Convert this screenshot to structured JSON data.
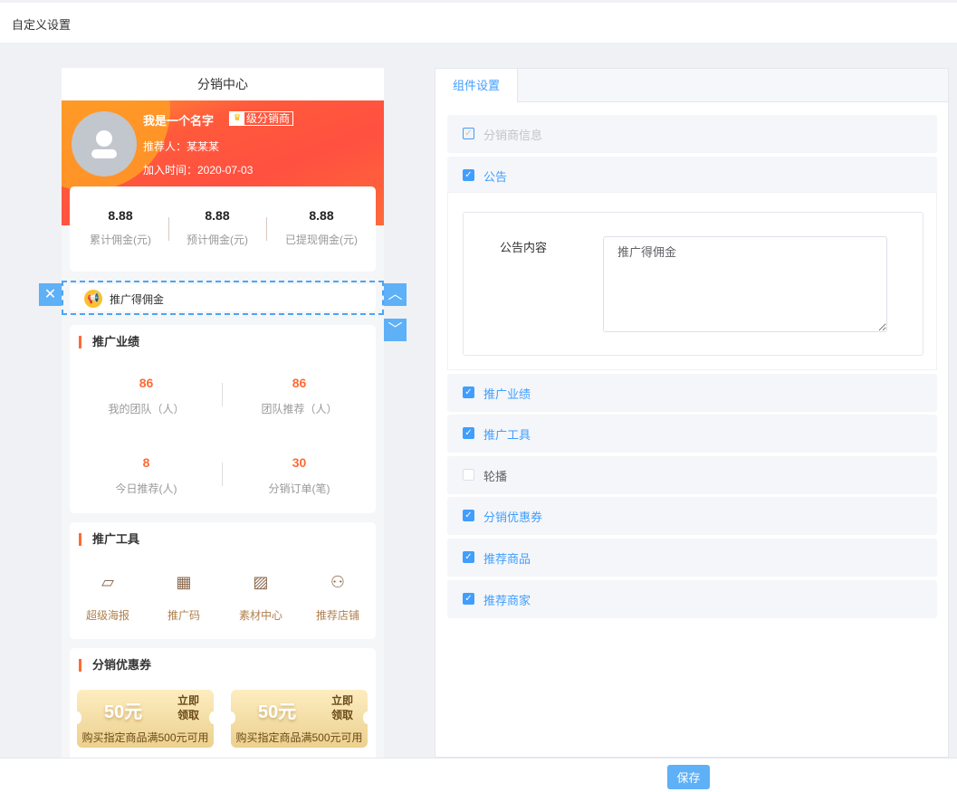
{
  "page_title": "自定义设置",
  "preview": {
    "title": "分销中心",
    "user": {
      "name": "我是一个名字",
      "level": "级分销商",
      "referrer": "推荐人：某某某",
      "join_time": "加入时间：2020-07-03"
    },
    "stats": [
      {
        "value": "8.88",
        "label": "累计佣金(元)"
      },
      {
        "value": "8.88",
        "label": "预计佣金(元)"
      },
      {
        "value": "8.88",
        "label": "已提现佣金(元)"
      }
    ],
    "notice": "推广得佣金",
    "performance": {
      "title": "推广业绩",
      "items": [
        {
          "value": "86",
          "label": "我的团队（人）"
        },
        {
          "value": "86",
          "label": "团队推荐（人）"
        },
        {
          "value": "8",
          "label": "今日推荐(人)"
        },
        {
          "value": "30",
          "label": "分销订单(笔)"
        }
      ]
    },
    "tools": {
      "title": "推广工具",
      "items": [
        {
          "label": "超级海报",
          "icon": "poster-icon"
        },
        {
          "label": "推广码",
          "icon": "qrcode-icon"
        },
        {
          "label": "素材中心",
          "icon": "image-icon"
        },
        {
          "label": "推荐店铺",
          "icon": "shop-hand-icon"
        }
      ]
    },
    "coupons": {
      "title": "分销优惠券",
      "items": [
        {
          "amount": "50元",
          "action": "立即领取",
          "condition": "购买指定商品满500元可用"
        },
        {
          "amount": "50元",
          "action": "立即领取",
          "condition": "购买指定商品满500元可用"
        }
      ]
    }
  },
  "panel": {
    "tab": "组件设置",
    "components": [
      {
        "label": "分销商信息",
        "checked": true,
        "disabled": true
      },
      {
        "label": "公告",
        "checked": true
      },
      {
        "label": "推广业绩",
        "checked": true
      },
      {
        "label": "推广工具",
        "checked": true
      },
      {
        "label": "轮播",
        "checked": false
      },
      {
        "label": "分销优惠券",
        "checked": true
      },
      {
        "label": "推荐商品",
        "checked": true
      },
      {
        "label": "推荐商家",
        "checked": true
      }
    ],
    "notice_form": {
      "label": "公告内容",
      "value": "推广得佣金"
    }
  },
  "save_label": "保存",
  "accent": "#409eff"
}
